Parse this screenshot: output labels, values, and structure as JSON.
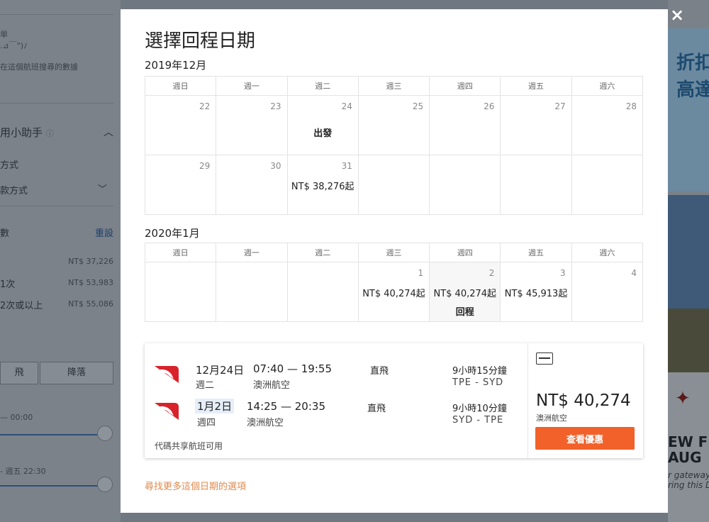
{
  "background": {
    "left": {
      "frag1": "在這個航班搜尋的數據",
      "helper_title": "用小助手",
      "pay_label": "方式",
      "pay_select": "款方式",
      "stops_label": "數",
      "reset": "重設",
      "price_direct": "NT$ 37,226",
      "stop1": "1次",
      "price_1": "NT$ 53,983",
      "stop2": "2次或以上",
      "price_2": "NT$ 55,086",
      "btn_takeoff": "飛",
      "btn_land": "降落",
      "time_range1": "— 00:00",
      "time_range2": "- 週五 22:30"
    },
    "ads": {
      "ad1_line1": "折扣",
      "ad1_line2": "高達",
      "ad3_line1": "EW F",
      "ad3_line2": "AUG",
      "ad3_line3": "r gateway",
      "ad3_line4": "ring this D"
    }
  },
  "modal": {
    "title": "選擇回程日期",
    "close_icon": "×",
    "weekdays": [
      "週日",
      "週一",
      "週二",
      "週三",
      "週四",
      "週五",
      "週六"
    ],
    "months": [
      {
        "label": "2019年12月",
        "weeks": [
          [
            {
              "day": "22",
              "price": "",
              "tag": ""
            },
            {
              "day": "23",
              "price": "",
              "tag": ""
            },
            {
              "day": "24",
              "price": "",
              "tag": "出發"
            },
            {
              "day": "25",
              "price": "",
              "tag": ""
            },
            {
              "day": "26",
              "price": "",
              "tag": ""
            },
            {
              "day": "27",
              "price": "",
              "tag": ""
            },
            {
              "day": "28",
              "price": "",
              "tag": ""
            }
          ],
          [
            {
              "day": "29",
              "price": "",
              "tag": ""
            },
            {
              "day": "30",
              "price": "",
              "tag": ""
            },
            {
              "day": "31",
              "price": "NT$ 38,276起",
              "tag": ""
            },
            {
              "day": "",
              "price": "",
              "tag": ""
            },
            {
              "day": "",
              "price": "",
              "tag": ""
            },
            {
              "day": "",
              "price": "",
              "tag": ""
            },
            {
              "day": "",
              "price": "",
              "tag": ""
            }
          ]
        ]
      },
      {
        "label": "2020年1月",
        "weeks": [
          [
            {
              "day": "",
              "price": "",
              "tag": ""
            },
            {
              "day": "",
              "price": "",
              "tag": ""
            },
            {
              "day": "",
              "price": "",
              "tag": ""
            },
            {
              "day": "1",
              "price": "NT$ 40,274起",
              "tag": ""
            },
            {
              "day": "2",
              "price": "NT$ 40,274起",
              "tag": "回程"
            },
            {
              "day": "3",
              "price": "NT$ 45,913起",
              "tag": ""
            },
            {
              "day": "4",
              "price": "",
              "tag": ""
            }
          ]
        ]
      }
    ],
    "flight": {
      "legs": [
        {
          "date": "12月24日",
          "weekday": "週二",
          "time": "07:40 — 19:55",
          "airline": "澳洲航空",
          "stops": "直飛",
          "duration": "9小時15分鐘",
          "route": "TPE - SYD"
        },
        {
          "date": "1月2日",
          "weekday": "週四",
          "time": "14:25 — 20:35",
          "airline": "澳洲航空",
          "stops": "直飛",
          "duration": "9小時10分鐘",
          "route": "SYD - TPE"
        }
      ],
      "codeshare": "代碼共享航班可用",
      "price": "NT$ 40,274",
      "price_airline": "澳洲航空",
      "deal_button": "查看優惠"
    },
    "more_link": "尋找更多這個日期的選項",
    "colors": {
      "accent": "#f2612a",
      "link": "#e08a4e",
      "qantas_red": "#d8232a"
    }
  }
}
